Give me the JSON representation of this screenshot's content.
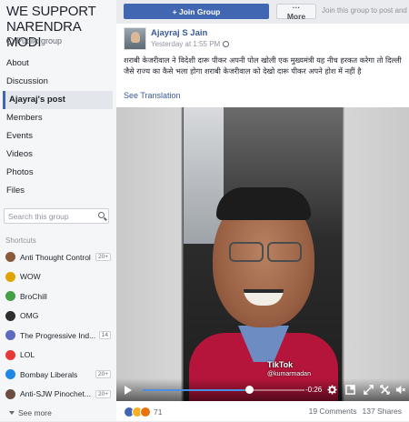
{
  "group": {
    "title": "WE SUPPORT NARENDRA MODI",
    "privacy": "Public group"
  },
  "nav": [
    {
      "label": "About"
    },
    {
      "label": "Discussion"
    },
    {
      "label": "Ajayraj's post"
    },
    {
      "label": "Members"
    },
    {
      "label": "Events"
    },
    {
      "label": "Videos"
    },
    {
      "label": "Photos"
    },
    {
      "label": "Files"
    }
  ],
  "search": {
    "placeholder": "Search this group"
  },
  "shortcuts": {
    "heading": "Shortcuts",
    "items": [
      {
        "label": "Anti Thought Control",
        "badge": "20+",
        "color": "#8a5a3c"
      },
      {
        "label": "WOW",
        "badge": "",
        "color": "#e0a400"
      },
      {
        "label": "BroChill",
        "badge": "",
        "color": "#43a047"
      },
      {
        "label": "OMG",
        "badge": "",
        "color": "#2e2e2e"
      },
      {
        "label": "The Progressive Ind...",
        "badge": "14",
        "color": "#5c6bc0"
      },
      {
        "label": "LOL",
        "badge": "",
        "color": "#e53935"
      },
      {
        "label": "Bombay Liberals",
        "badge": "20+",
        "color": "#1e88e5"
      },
      {
        "label": "Anti-SJW Pinochet...",
        "badge": "20+",
        "color": "#6d4c41"
      }
    ],
    "see_more": "See more"
  },
  "topbar": {
    "join_label": "+ Join Group",
    "more_label": "··· More",
    "hint": "Join this group to post and c"
  },
  "post": {
    "author": "Ajayraj S Jain",
    "time": "Yesterday at 1:55 PM",
    "text": "शराबी केजरीवाल ने विदेशी दारू पीकर अपनी पोल खोली एक मुख्यमंत्री यह नीच हरकत करेगा तो दिल्ली जैसे राज्य का कैसे भला होगा शराबी केजरीवाल को देखो दारू पीकर अपने होश में नहीं है",
    "see_translation": "See Translation",
    "video": {
      "watermark": "TikTok",
      "username": "@kumarmadan",
      "remaining": "-0:26",
      "progress": 0.66
    },
    "reactions_count": "71",
    "comments": "19 Comments",
    "shares": "137 Shares"
  }
}
